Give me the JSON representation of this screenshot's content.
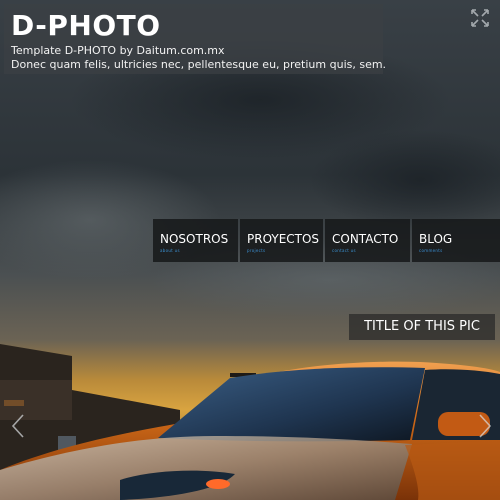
{
  "site": {
    "title": "D-PHOTO",
    "tagline_line1": "Template D-PHOTO by Daitum.com.mx",
    "tagline_line2": "Donec quam felis, ultricies nec, pellentesque eu, pretium quis, sem."
  },
  "nav": {
    "items": [
      {
        "label": "NOSOTROS",
        "sub": "about us"
      },
      {
        "label": "PROYECTOS",
        "sub": "projects"
      },
      {
        "label": "CONTACTO",
        "sub": "contact us"
      },
      {
        "label": "BLOG",
        "sub": "comments"
      }
    ]
  },
  "slide": {
    "title": "TITLE OF THIS PIC"
  },
  "icons": {
    "fullscreen": "fullscreen-icon",
    "prev": "chevron-left-icon",
    "next": "chevron-right-icon"
  },
  "colors": {
    "accent": "#3a8fd0",
    "car": "#d9731f",
    "sky": "#3a4248"
  }
}
